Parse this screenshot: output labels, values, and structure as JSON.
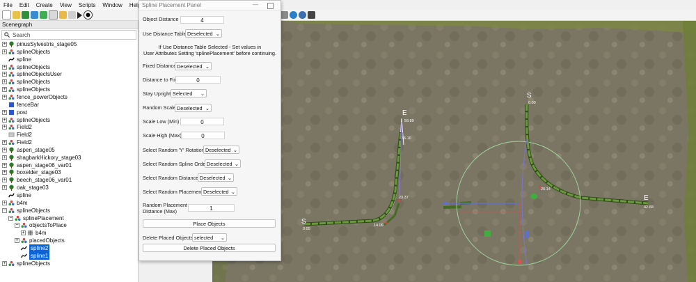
{
  "menu": [
    "File",
    "Edit",
    "Create",
    "View",
    "Scripts",
    "Window",
    "Help"
  ],
  "scenegraph": {
    "title": "Scenegraph",
    "search_placeholder": "Search",
    "items": [
      {
        "label": "pinusSylvestris_stage05",
        "icon": "tree-icon",
        "exp": "+",
        "indent": 0
      },
      {
        "label": "splineObjects",
        "icon": "group-icon",
        "exp": "+",
        "indent": 0
      },
      {
        "label": "spline",
        "icon": "spline-icon",
        "exp": "",
        "indent": 0
      },
      {
        "label": "splineObjects",
        "icon": "group-icon",
        "exp": "+",
        "indent": 0
      },
      {
        "label": "splineObjectsUser",
        "icon": "group-icon",
        "exp": "+",
        "indent": 0
      },
      {
        "label": "splineObjects",
        "icon": "group-icon",
        "exp": "+",
        "indent": 0
      },
      {
        "label": "splineObjects",
        "icon": "group-icon",
        "exp": "+",
        "indent": 0
      },
      {
        "label": "fence_powerObjects",
        "icon": "group-icon",
        "exp": "+",
        "indent": 0
      },
      {
        "label": "fenceBar",
        "icon": "cube-icon",
        "exp": "",
        "indent": 0
      },
      {
        "label": "post",
        "icon": "cube-icon",
        "exp": "+",
        "indent": 0
      },
      {
        "label": "splineObjects",
        "icon": "group-icon",
        "exp": "+",
        "indent": 0
      },
      {
        "label": "Field2",
        "icon": "group-icon",
        "exp": "+",
        "indent": 0
      },
      {
        "label": "Field2",
        "icon": "field-icon",
        "exp": "",
        "indent": 0
      },
      {
        "label": "Field2",
        "icon": "group-icon",
        "exp": "+",
        "indent": 0
      },
      {
        "label": "aspen_stage05",
        "icon": "tree-icon",
        "exp": "+",
        "indent": 0
      },
      {
        "label": "shagbarkHickory_stage03",
        "icon": "tree-icon",
        "exp": "+",
        "indent": 0
      },
      {
        "label": "aspen_stage06_var01",
        "icon": "tree-icon",
        "exp": "+",
        "indent": 0
      },
      {
        "label": "boxelder_stage03",
        "icon": "tree-icon",
        "exp": "+",
        "indent": 0
      },
      {
        "label": "beech_stage06_var01",
        "icon": "tree-icon",
        "exp": "+",
        "indent": 0
      },
      {
        "label": "oak_stage03",
        "icon": "tree-icon",
        "exp": "+",
        "indent": 0
      },
      {
        "label": "spline",
        "icon": "spline-icon",
        "exp": "",
        "indent": 0
      },
      {
        "label": "b4m",
        "icon": "group-icon",
        "exp": "+",
        "indent": 0
      },
      {
        "label": "splineObjects",
        "icon": "group-icon",
        "exp": "−",
        "indent": 0
      },
      {
        "label": "splinePlacement",
        "icon": "group-icon",
        "exp": "−",
        "indent": 1
      },
      {
        "label": "objectsToPlace",
        "icon": "group-icon",
        "exp": "−",
        "indent": 2
      },
      {
        "label": "b4m",
        "icon": "mesh-icon",
        "exp": "+",
        "indent": 3
      },
      {
        "label": "placedObjects",
        "icon": "group-icon",
        "exp": "+",
        "indent": 2
      },
      {
        "label": "spline2",
        "icon": "spline-icon",
        "exp": "",
        "indent": 2,
        "selected": true
      },
      {
        "label": "spline1",
        "icon": "spline-icon",
        "exp": "",
        "indent": 2,
        "selected": true
      },
      {
        "label": "splineObjects",
        "icon": "group-icon",
        "exp": "+",
        "indent": 0
      }
    ]
  },
  "panel": {
    "title": "Spline Placement Panel",
    "object_distance_label": "Object Distance",
    "object_distance_value": "4",
    "use_distance_table_label": "Use Distance Table",
    "use_distance_table_value": "Deselected",
    "note_line1": "If Use Distance Table Selected - Set values in",
    "note_line2": "User Attributes Setting 'splinePlacement' before continuing.",
    "fixed_distance_label": "Fixed Distance",
    "fixed_distance_value": "Deselected",
    "distance_to_fix_label": "Distance to Fix",
    "distance_to_fix_value": "0",
    "stay_upright_label": "Stay Upright",
    "stay_upright_value": "Selected",
    "random_scale_label": "Random Scale",
    "random_scale_value": "Deselected",
    "scale_low_label": "Scale Low (Min)",
    "scale_low_value": "0",
    "scale_high_label": "Scale High (Max)",
    "scale_high_value": "0",
    "random_y_rotation_label": "Select Random 'Y' Rotation",
    "random_y_rotation_value": "Deselected",
    "random_spline_order_label": "Select Random Spline Order",
    "random_spline_order_value": "Deselected",
    "random_distance_label": "Select Random Distance",
    "random_distance_value": "Deselected",
    "random_placement_label": "Select Random Placement",
    "random_placement_value": "Deselected",
    "random_placement_distance_label1": "Random Placement",
    "random_placement_distance_label2": "Distance (Max)",
    "random_placement_distance_value": "1",
    "place_objects_button": "Place Objects",
    "delete_placed_objects_label": "Delete Placed Objects",
    "delete_placed_objects_value": "selected",
    "delete_placed_objects_button": "Delete Placed Objects"
  },
  "viewport": {
    "spline1": {
      "start_marker": "S",
      "start_value": "0.00",
      "end_marker": "E",
      "end_value": "59.89",
      "point_labels": [
        "14.06",
        "23.37",
        "36.10"
      ]
    },
    "spline2": {
      "start_marker": "S",
      "start_value": "0.00",
      "end_marker": "E",
      "end_value": "42.68",
      "point_labels": [
        "20.14"
      ]
    }
  }
}
